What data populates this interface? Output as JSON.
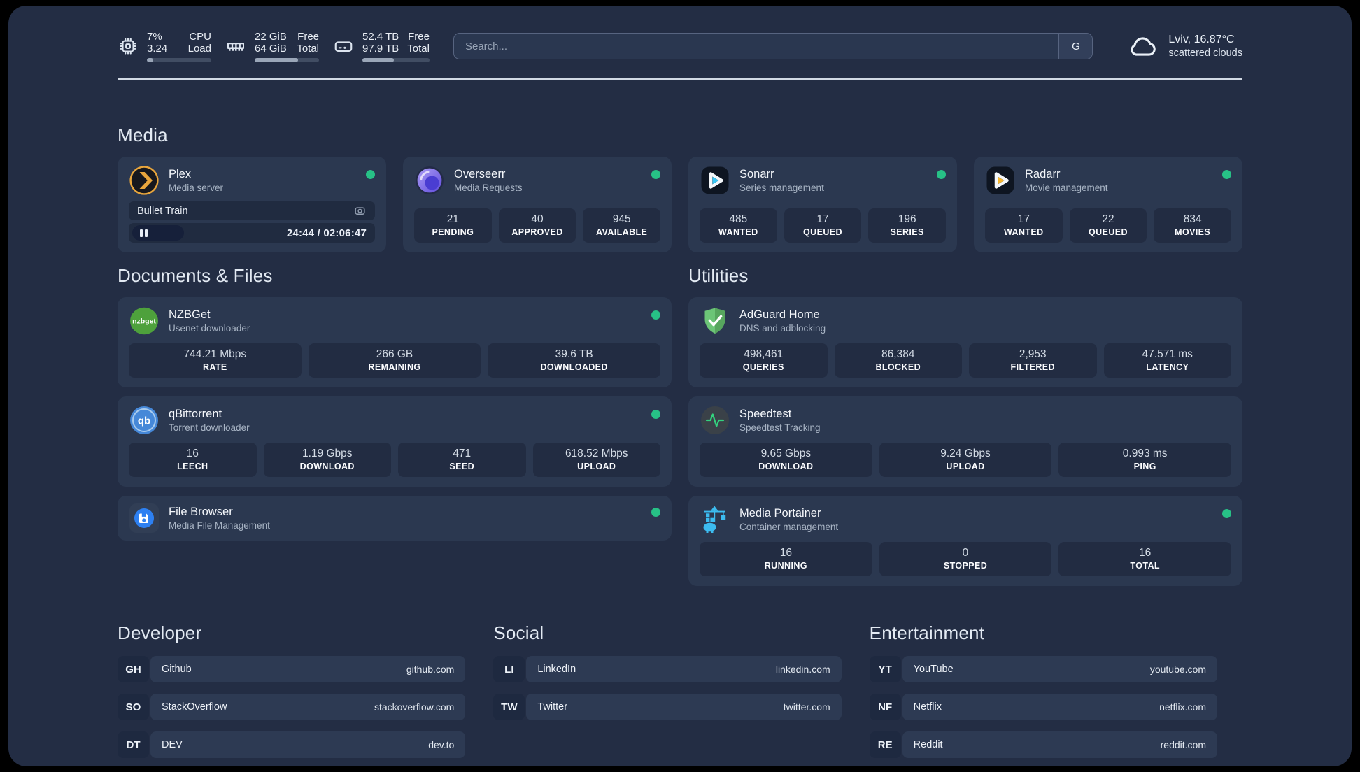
{
  "header": {
    "stats": [
      {
        "icon": "cpu-icon",
        "values": [
          "7%",
          "3.24"
        ],
        "labels": [
          "CPU",
          "Load"
        ],
        "progress": 10
      },
      {
        "icon": "memory-icon",
        "values": [
          "22 GiB",
          "64 GiB"
        ],
        "labels": [
          "Free",
          "Total"
        ],
        "progress": 67
      },
      {
        "icon": "disk-icon",
        "values": [
          "52.4 TB",
          "97.9 TB"
        ],
        "labels": [
          "Free",
          "Total"
        ],
        "progress": 47
      }
    ],
    "search": {
      "placeholder": "Search...",
      "button": "G"
    },
    "weather": {
      "location": "Lviv, 16.87°C",
      "condition": "scattered clouds"
    }
  },
  "sections": {
    "media": {
      "title": "Media"
    },
    "documents": {
      "title": "Documents & Files"
    },
    "utilities": {
      "title": "Utilities"
    },
    "developer": {
      "title": "Developer"
    },
    "social": {
      "title": "Social"
    },
    "entertainment": {
      "title": "Entertainment"
    }
  },
  "apps": {
    "plex": {
      "name": "Plex",
      "subtitle": "Media server",
      "online": true,
      "now_playing": {
        "title": "Bullet Train",
        "state": "paused",
        "time": "24:44 / 02:06:47"
      }
    },
    "overseerr": {
      "name": "Overseerr",
      "subtitle": "Media Requests",
      "online": true,
      "tiles": [
        {
          "value": "21",
          "label": "PENDING"
        },
        {
          "value": "40",
          "label": "APPROVED"
        },
        {
          "value": "945",
          "label": "AVAILABLE"
        }
      ]
    },
    "sonarr": {
      "name": "Sonarr",
      "subtitle": "Series management",
      "online": true,
      "tiles": [
        {
          "value": "485",
          "label": "WANTED"
        },
        {
          "value": "17",
          "label": "QUEUED"
        },
        {
          "value": "196",
          "label": "SERIES"
        }
      ]
    },
    "radarr": {
      "name": "Radarr",
      "subtitle": "Movie management",
      "online": true,
      "tiles": [
        {
          "value": "17",
          "label": "WANTED"
        },
        {
          "value": "22",
          "label": "QUEUED"
        },
        {
          "value": "834",
          "label": "MOVIES"
        }
      ]
    },
    "nzbget": {
      "name": "NZBGet",
      "subtitle": "Usenet downloader",
      "online": true,
      "tiles": [
        {
          "value": "744.21 Mbps",
          "label": "RATE"
        },
        {
          "value": "266 GB",
          "label": "REMAINING"
        },
        {
          "value": "39.6 TB",
          "label": "DOWNLOADED"
        }
      ]
    },
    "qbittorrent": {
      "name": "qBittorrent",
      "subtitle": "Torrent downloader",
      "online": true,
      "tiles": [
        {
          "value": "16",
          "label": "LEECH"
        },
        {
          "value": "1.19 Gbps",
          "label": "DOWNLOAD"
        },
        {
          "value": "471",
          "label": "SEED"
        },
        {
          "value": "618.52 Mbps",
          "label": "UPLOAD"
        }
      ]
    },
    "filebrowser": {
      "name": "File Browser",
      "subtitle": "Media File Management",
      "online": true
    },
    "adguard": {
      "name": "AdGuard Home",
      "subtitle": "DNS and adblocking",
      "tiles": [
        {
          "value": "498,461",
          "label": "QUERIES"
        },
        {
          "value": "86,384",
          "label": "BLOCKED"
        },
        {
          "value": "2,953",
          "label": "FILTERED"
        },
        {
          "value": "47.571 ms",
          "label": "LATENCY"
        }
      ]
    },
    "speedtest": {
      "name": "Speedtest",
      "subtitle": "Speedtest Tracking",
      "tiles": [
        {
          "value": "9.65 Gbps",
          "label": "DOWNLOAD"
        },
        {
          "value": "9.24 Gbps",
          "label": "UPLOAD"
        },
        {
          "value": "0.993 ms",
          "label": "PING"
        }
      ]
    },
    "portainer": {
      "name": "Media Portainer",
      "subtitle": "Container management",
      "online": true,
      "tiles": [
        {
          "value": "16",
          "label": "RUNNING"
        },
        {
          "value": "0",
          "label": "STOPPED"
        },
        {
          "value": "16",
          "label": "TOTAL"
        }
      ]
    }
  },
  "bookmarks": {
    "developer": [
      {
        "abbr": "GH",
        "name": "Github",
        "url": "github.com"
      },
      {
        "abbr": "SO",
        "name": "StackOverflow",
        "url": "stackoverflow.com"
      },
      {
        "abbr": "DT",
        "name": "DEV",
        "url": "dev.to"
      }
    ],
    "social": [
      {
        "abbr": "LI",
        "name": "LinkedIn",
        "url": "linkedin.com"
      },
      {
        "abbr": "TW",
        "name": "Twitter",
        "url": "twitter.com"
      }
    ],
    "entertainment": [
      {
        "abbr": "YT",
        "name": "YouTube",
        "url": "youtube.com"
      },
      {
        "abbr": "NF",
        "name": "Netflix",
        "url": "netflix.com"
      },
      {
        "abbr": "RE",
        "name": "Reddit",
        "url": "reddit.com"
      }
    ]
  },
  "colors": {
    "status_online": "#27c186",
    "panel_bg": "#232d44",
    "card_bg": "#2b3850"
  }
}
